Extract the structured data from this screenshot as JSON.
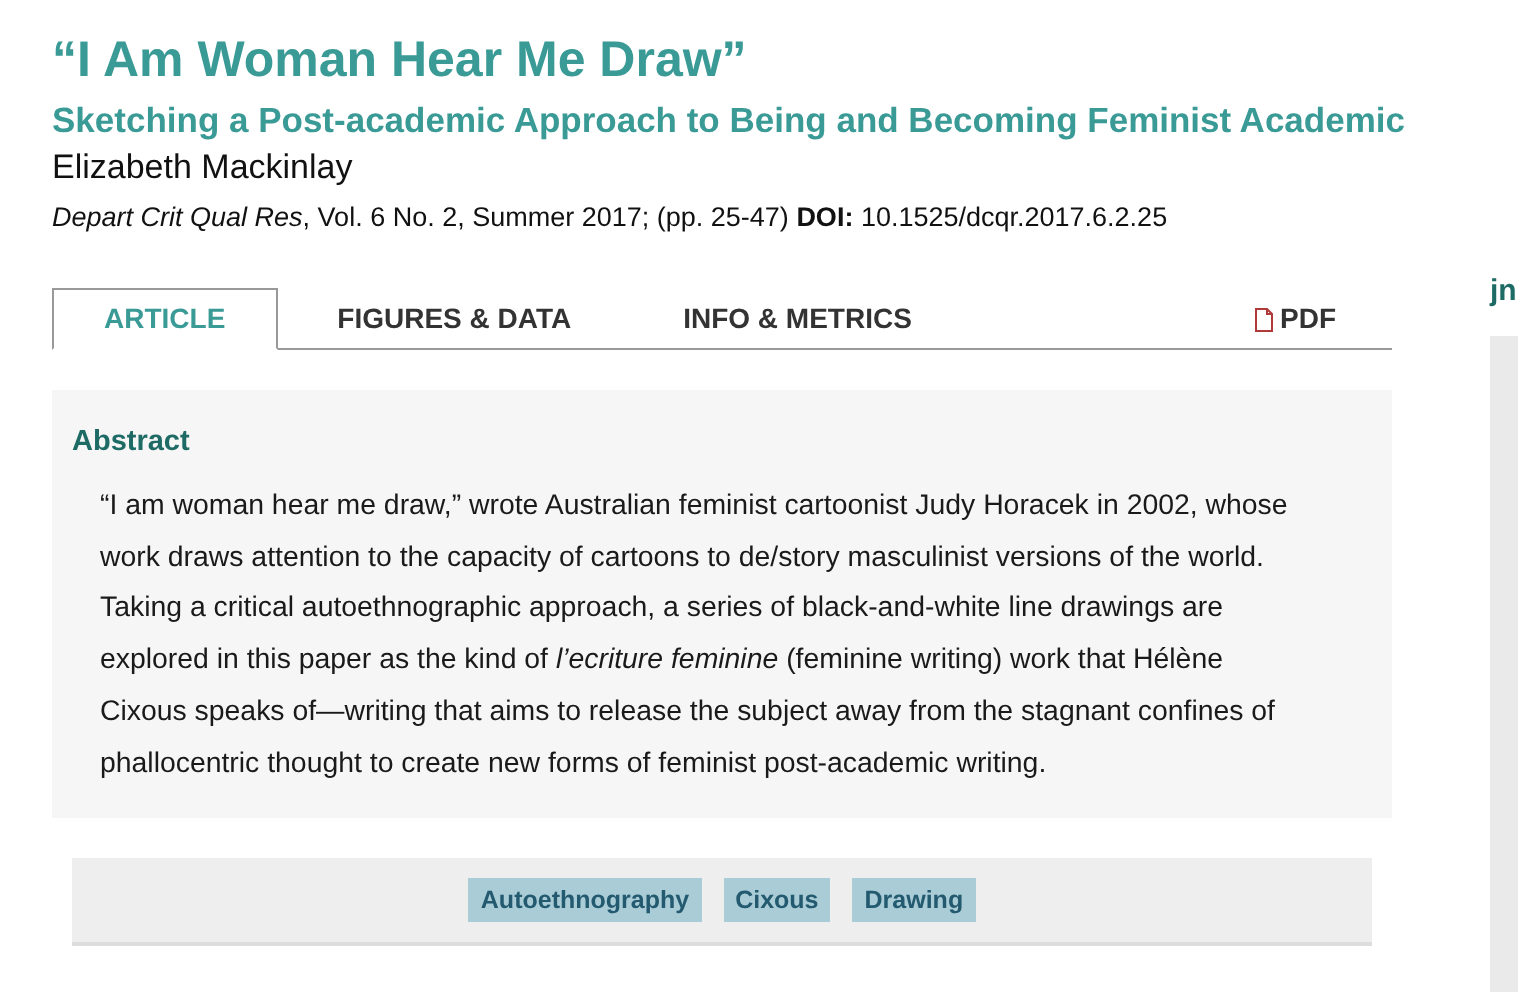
{
  "article": {
    "title": "“I Am Woman Hear Me Draw”",
    "subtitle": "Sketching a Post-academic Approach to Being and Becoming Feminist Academic",
    "author": "Elizabeth Mackinlay",
    "citation": "*Depart Crit Qual Res*, Vol. 6 No. 2, Summer 2017; (pp. 25-47) **DOI:** 10.1525/dcqr.2017.6.2.25"
  },
  "tabs": [
    {
      "label": "ARTICLE",
      "selected": true
    },
    {
      "label": "FIGURES & DATA",
      "selected": false
    },
    {
      "label": "INFO & METRICS",
      "selected": false
    }
  ],
  "pdf_link": "PDF",
  "abstract": {
    "heading": "Abstract",
    "text": "“I am woman hear me draw,” wrote Australian feminist cartoonist Judy Horacek in 2002, whose work draws attention to the capacity of cartoons to de/story masculinist versions of the world. Taking a critical autoethnographic approach, a series of black-and-white line drawings are explored in this paper as the kind of *l’ecriture feminine* (feminine writing) work that Hélène Cixous speaks of—writing that aims to release the subject away from the stagnant confines of phallocentric thought to create new forms of feminist post-academic writing."
  },
  "keywords": [
    "Autoethnography",
    "Cixous",
    "Drawing"
  ],
  "sidebar": {
    "heading": "jn"
  }
}
